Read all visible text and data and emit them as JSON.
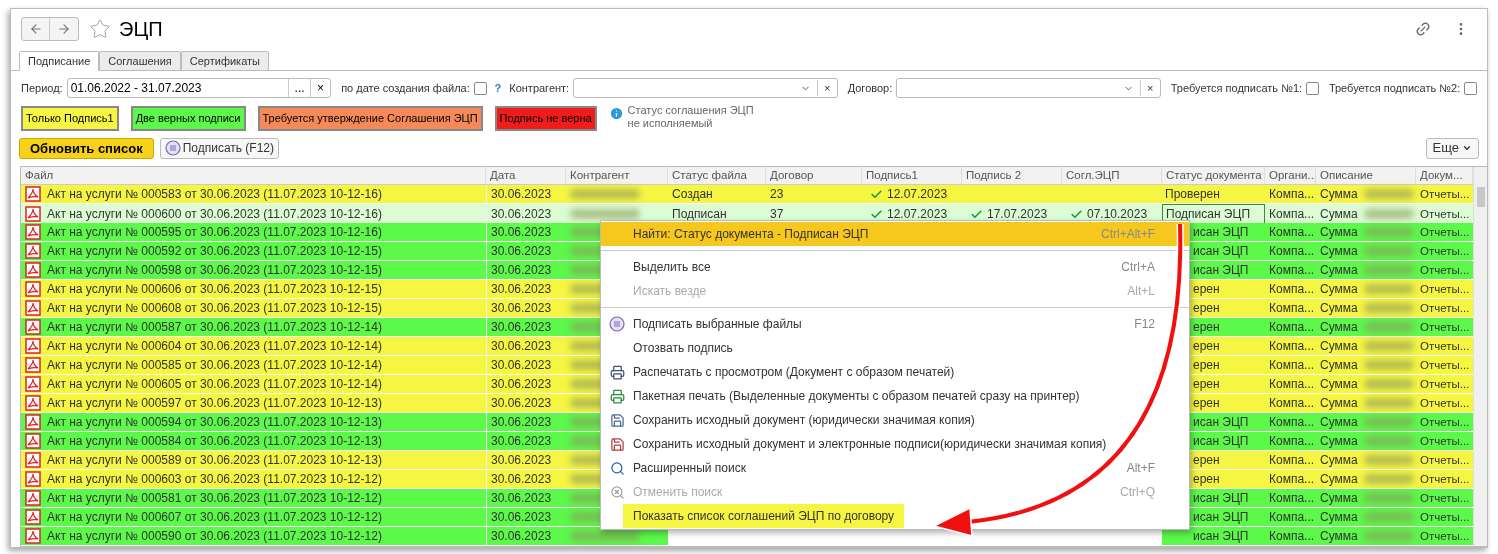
{
  "window": {
    "title": "ЭЦП"
  },
  "tabs": [
    {
      "label": "Подписание",
      "selected": true
    },
    {
      "label": "Соглашения",
      "selected": false
    },
    {
      "label": "Сертификаты",
      "selected": false
    }
  ],
  "filters": {
    "period_label": "Период:",
    "period_value": "01.06.2022 - 31.07.2023",
    "period_pick": "...",
    "clear": "×",
    "by_date_label": "по дате создания файла:",
    "by_date_checked": false,
    "help": "?",
    "contragent_label": "Контрагент:",
    "contract_label": "Договор:",
    "req1_label": "Требуется подписать №1:",
    "req1_checked": false,
    "req2_label": "Требуется подписать №2:",
    "req2_checked": false
  },
  "legend": [
    {
      "label": "Только Подпись1",
      "color": "#f5f542"
    },
    {
      "label": "Две верных подписи",
      "color": "#5cf84a"
    },
    {
      "label": "Требуется утверждение Соглашения ЭЦП",
      "color": "#f58a58"
    },
    {
      "label": "Подпись не верна",
      "color": "#f01c1c"
    }
  ],
  "info": "Статус соглашения ЭЦП не исполняемый",
  "buttons": {
    "refresh": "Обновить список",
    "sign": "Подписать (F12)",
    "more": "Еще"
  },
  "table": {
    "columns": [
      "Файл",
      "Дата",
      "Контрагент",
      "Статус файла",
      "Договор",
      "Подпись1",
      "Подпись 2",
      "Согл.ЭЦП",
      "Статус документа",
      "Органи...",
      "Описание",
      "Докум..."
    ],
    "rows": [
      {
        "file": "Акт на услуги № 000583 от 30.06.2023 (11.07.2023 10-12-16)",
        "date": "30.06.2023",
        "color": "#f5f542",
        "selected": false,
        "file_status": "Создан",
        "contract": "23",
        "sign1": "12.07.2023",
        "doc_status": "Проверен",
        "org": "Компа...",
        "description": "Сумма",
        "doc_type": "Отчеты..."
      },
      {
        "file": "Акт на услуги № 000600 от 30.06.2023 (11.07.2023 10-12-16)",
        "date": "30.06.2023",
        "selected": true,
        "file_status": "Подписан",
        "contract": "37",
        "sign1": "12.07.2023",
        "sign2": "17.07.2023",
        "agreement": "07.10.2023",
        "doc_status": "Подписан ЭЦП",
        "org": "Компа...",
        "description": "Сумма",
        "doc_type": "Отчеты..."
      },
      {
        "file": "Акт на услуги № 000595 от 30.06.2023 (11.07.2023 10-12-16)",
        "date": "30.06.2023",
        "color": "#5cf84a",
        "selected": false,
        "doc_status": "исан ЭЦП",
        "org": "Компа...",
        "description": "Сумма",
        "doc_type": "Отчеты..."
      },
      {
        "file": "Акт на услуги № 000592 от 30.06.2023 (11.07.2023 10-12-15)",
        "date": "30.06.2023",
        "color": "#5cf84a",
        "selected": false,
        "doc_status": "исан ЭЦП",
        "org": "Компа...",
        "description": "Сумма",
        "doc_type": "Отчеты..."
      },
      {
        "file": "Акт на услуги № 000598 от 30.06.2023 (11.07.2023 10-12-15)",
        "date": "30.06.2023",
        "color": "#5cf84a",
        "selected": false,
        "doc_status": "исан ЭЦП",
        "org": "Компа...",
        "description": "Сумма",
        "doc_type": "Отчеты..."
      },
      {
        "file": "Акт на услуги № 000606 от 30.06.2023 (11.07.2023 10-12-15)",
        "date": "30.06.2023",
        "color": "#f5f542",
        "selected": false,
        "doc_status": "ерен",
        "org": "Компа...",
        "description": "Сумма",
        "doc_type": "Отчеты..."
      },
      {
        "file": "Акт на услуги № 000608 от 30.06.2023 (11.07.2023 10-12-15)",
        "date": "30.06.2023",
        "color": "#f5f542",
        "selected": false,
        "doc_status": "ерен",
        "org": "Компа...",
        "description": "Сумма",
        "doc_type": "Отчеты..."
      },
      {
        "file": "Акт на услуги № 000587 от 30.06.2023 (11.07.2023 10-12-14)",
        "date": "30.06.2023",
        "color": "#5cf84a",
        "selected": false,
        "doc_status": "ерен",
        "org": "Компа...",
        "description": "Сумма",
        "doc_type": "Отчеты..."
      },
      {
        "file": "Акт на услуги № 000604 от 30.06.2023 (11.07.2023 10-12-14)",
        "date": "30.06.2023",
        "color": "#f5f542",
        "selected": false,
        "doc_status": "ерен",
        "org": "Компа...",
        "description": "Сумма",
        "doc_type": "Отчеты..."
      },
      {
        "file": "Акт на услуги № 000585 от 30.06.2023 (11.07.2023 10-12-14)",
        "date": "30.06.2023",
        "color": "#f5f542",
        "selected": false,
        "doc_status": "ерен",
        "org": "Компа...",
        "description": "Сумма",
        "doc_type": "Отчеты..."
      },
      {
        "file": "Акт на услуги № 000605 от 30.06.2023 (11.07.2023 10-12-14)",
        "date": "30.06.2023",
        "color": "#f5f542",
        "selected": false,
        "doc_status": "ерен",
        "org": "Компа...",
        "description": "Сумма",
        "doc_type": "Отчеты..."
      },
      {
        "file": "Акт на услуги № 000597 от 30.06.2023 (11.07.2023 10-12-13)",
        "date": "30.06.2023",
        "color": "#f5f542",
        "selected": false,
        "doc_status": "ерен",
        "org": "Компа...",
        "description": "Сумма",
        "doc_type": "Отчеты..."
      },
      {
        "file": "Акт на услуги № 000594 от 30.06.2023 (11.07.2023 10-12-13)",
        "date": "30.06.2023",
        "color": "#5cf84a",
        "selected": false,
        "doc_status": "исан ЭЦП",
        "org": "Компа...",
        "description": "Сумма",
        "doc_type": "Отчеты..."
      },
      {
        "file": "Акт на услуги № 000584 от 30.06.2023 (11.07.2023 10-12-13)",
        "date": "30.06.2023",
        "color": "#5cf84a",
        "selected": false,
        "doc_status": "исан ЭЦП",
        "org": "Компа...",
        "description": "Сумма",
        "doc_type": "Отчеты..."
      },
      {
        "file": "Акт на услуги № 000589 от 30.06.2023 (11.07.2023 10-12-13)",
        "date": "30.06.2023",
        "color": "#f5f542",
        "selected": false,
        "doc_status": "ерен",
        "org": "Компа...",
        "description": "Сумма",
        "doc_type": "Отчеты..."
      },
      {
        "file": "Акт на услуги № 000603 от 30.06.2023 (11.07.2023 10-12-12)",
        "date": "30.06.2023",
        "color": "#f5f542",
        "selected": false,
        "doc_status": "ерен",
        "org": "Компа...",
        "description": "Сумма",
        "doc_type": "Отчеты..."
      },
      {
        "file": "Акт на услуги № 000581 от 30.06.2023 (11.07.2023 10-12-12)",
        "date": "30.06.2023",
        "color": "#5cf84a",
        "selected": false,
        "doc_status": "исан ЭЦП",
        "org": "Компа...",
        "description": "Сумма",
        "doc_type": "Отчеты..."
      },
      {
        "file": "Акт на услуги № 000607 от 30.06.2023 (11.07.2023 10-12-12)",
        "date": "30.06.2023",
        "color": "#5cf84a",
        "selected": false,
        "doc_status": "исан ЭЦП",
        "org": "Компа...",
        "description": "Сумма",
        "doc_type": "Отчеты..."
      },
      {
        "file": "Акт на услуги № 000590 от 30.06.2023 (11.07.2023 10-12-12)",
        "date": "30.06.2023",
        "color": "#5cf84a",
        "selected": false,
        "doc_status": "исан ЭЦП",
        "org": "Компа...",
        "description": "Сумма",
        "doc_type": "Отчеты..."
      }
    ]
  },
  "context_menu": [
    {
      "kind": "item",
      "label": "Найти: Статус документа - Подписан ЭЦП",
      "shortcut": "Ctrl+Alt+F",
      "selected": true,
      "disabled": false
    },
    {
      "kind": "separator"
    },
    {
      "kind": "item",
      "label": "Выделить все",
      "shortcut": "Ctrl+A",
      "selected": false,
      "disabled": false
    },
    {
      "kind": "item",
      "label": "Искать везде",
      "shortcut": "Alt+L",
      "selected": false,
      "disabled": true
    },
    {
      "kind": "separator"
    },
    {
      "kind": "item",
      "label": "Подписать выбранные файлы",
      "shortcut": "F12",
      "selected": false,
      "disabled": false
    },
    {
      "kind": "item",
      "label": "Отозвать подпись",
      "selected": false,
      "disabled": false
    },
    {
      "kind": "item",
      "label": "Распечатать с просмотром (Документ с образом печатей)",
      "selected": false,
      "disabled": false
    },
    {
      "kind": "item",
      "label": "Пакетная печать (Выделенные документы с образом печатей сразу на принтер)",
      "selected": false,
      "disabled": false
    },
    {
      "kind": "item",
      "label": "Сохранить исходный документ (юридически значимая копия)",
      "selected": false,
      "disabled": false
    },
    {
      "kind": "item",
      "label": "Сохранить исходный документ и электронные подписи(юридически значимая копия)",
      "selected": false,
      "disabled": false
    },
    {
      "kind": "item",
      "label": "Расширенный поиск",
      "shortcut": "Alt+F",
      "selected": false,
      "disabled": false
    },
    {
      "kind": "item",
      "label": "Отменить поиск",
      "shortcut": "Ctrl+Q",
      "selected": false,
      "disabled": true
    },
    {
      "kind": "item",
      "label": "Показать список соглашений ЭЦП по договору",
      "selected": false,
      "disabled": false,
      "highlighted": true
    }
  ]
}
